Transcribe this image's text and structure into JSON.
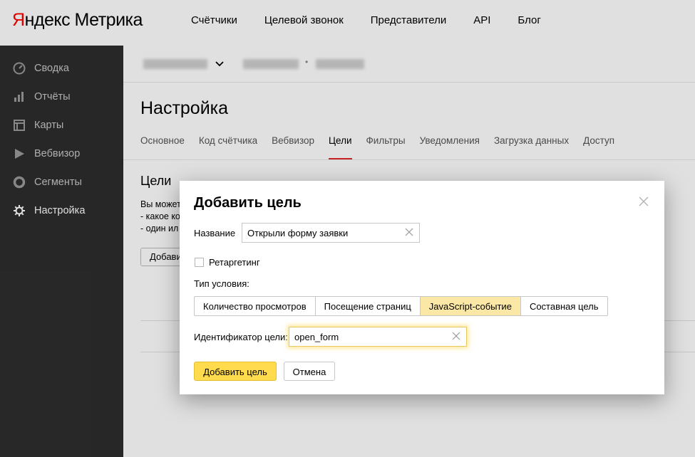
{
  "header": {
    "logo_ya": "Я",
    "logo_ya_rest": "ндекс",
    "logo_product": "Метрика",
    "nav": [
      "Счётчики",
      "Целевой звонок",
      "Представители",
      "API",
      "Блог"
    ]
  },
  "sidebar": {
    "items": [
      {
        "label": "Сводка",
        "icon": "gauge-icon"
      },
      {
        "label": "Отчёты",
        "icon": "bar-chart-icon"
      },
      {
        "label": "Карты",
        "icon": "map-icon"
      },
      {
        "label": "Вебвизор",
        "icon": "play-icon"
      },
      {
        "label": "Сегменты",
        "icon": "segments-icon"
      },
      {
        "label": "Настройка",
        "icon": "gear-icon"
      }
    ],
    "active": "Настройка"
  },
  "main": {
    "title": "Настройка",
    "tabs": [
      "Основное",
      "Код счётчика",
      "Вебвизор",
      "Цели",
      "Фильтры",
      "Уведомления",
      "Загрузка данных",
      "Доступ"
    ],
    "active_tab": "Цели",
    "section_title": "Цели",
    "section_text": [
      "Вы можете",
      "- какое ко",
      "- один ил"
    ],
    "section_button": "Добави"
  },
  "modal": {
    "title": "Добавить цель",
    "name_label": "Название",
    "name_value": "Открыли форму заявки",
    "retargeting_label": "Ретаргетинг",
    "condition_type_label": "Тип условия:",
    "condition_types": [
      "Количество просмотров",
      "Посещение страниц",
      "JavaScript-событие",
      "Составная цель"
    ],
    "active_condition": "JavaScript-событие",
    "id_label": "Идентификатор цели:",
    "id_value": "open_form",
    "submit_label": "Добавить цель",
    "cancel_label": "Отмена"
  },
  "colors": {
    "brand_red": "#ff0000",
    "accent_yellow": "#ffdb4d",
    "active_segment": "#fbe8a6",
    "sidebar_bg": "#2d2d2d",
    "tab_underline": "#e52a2a"
  }
}
